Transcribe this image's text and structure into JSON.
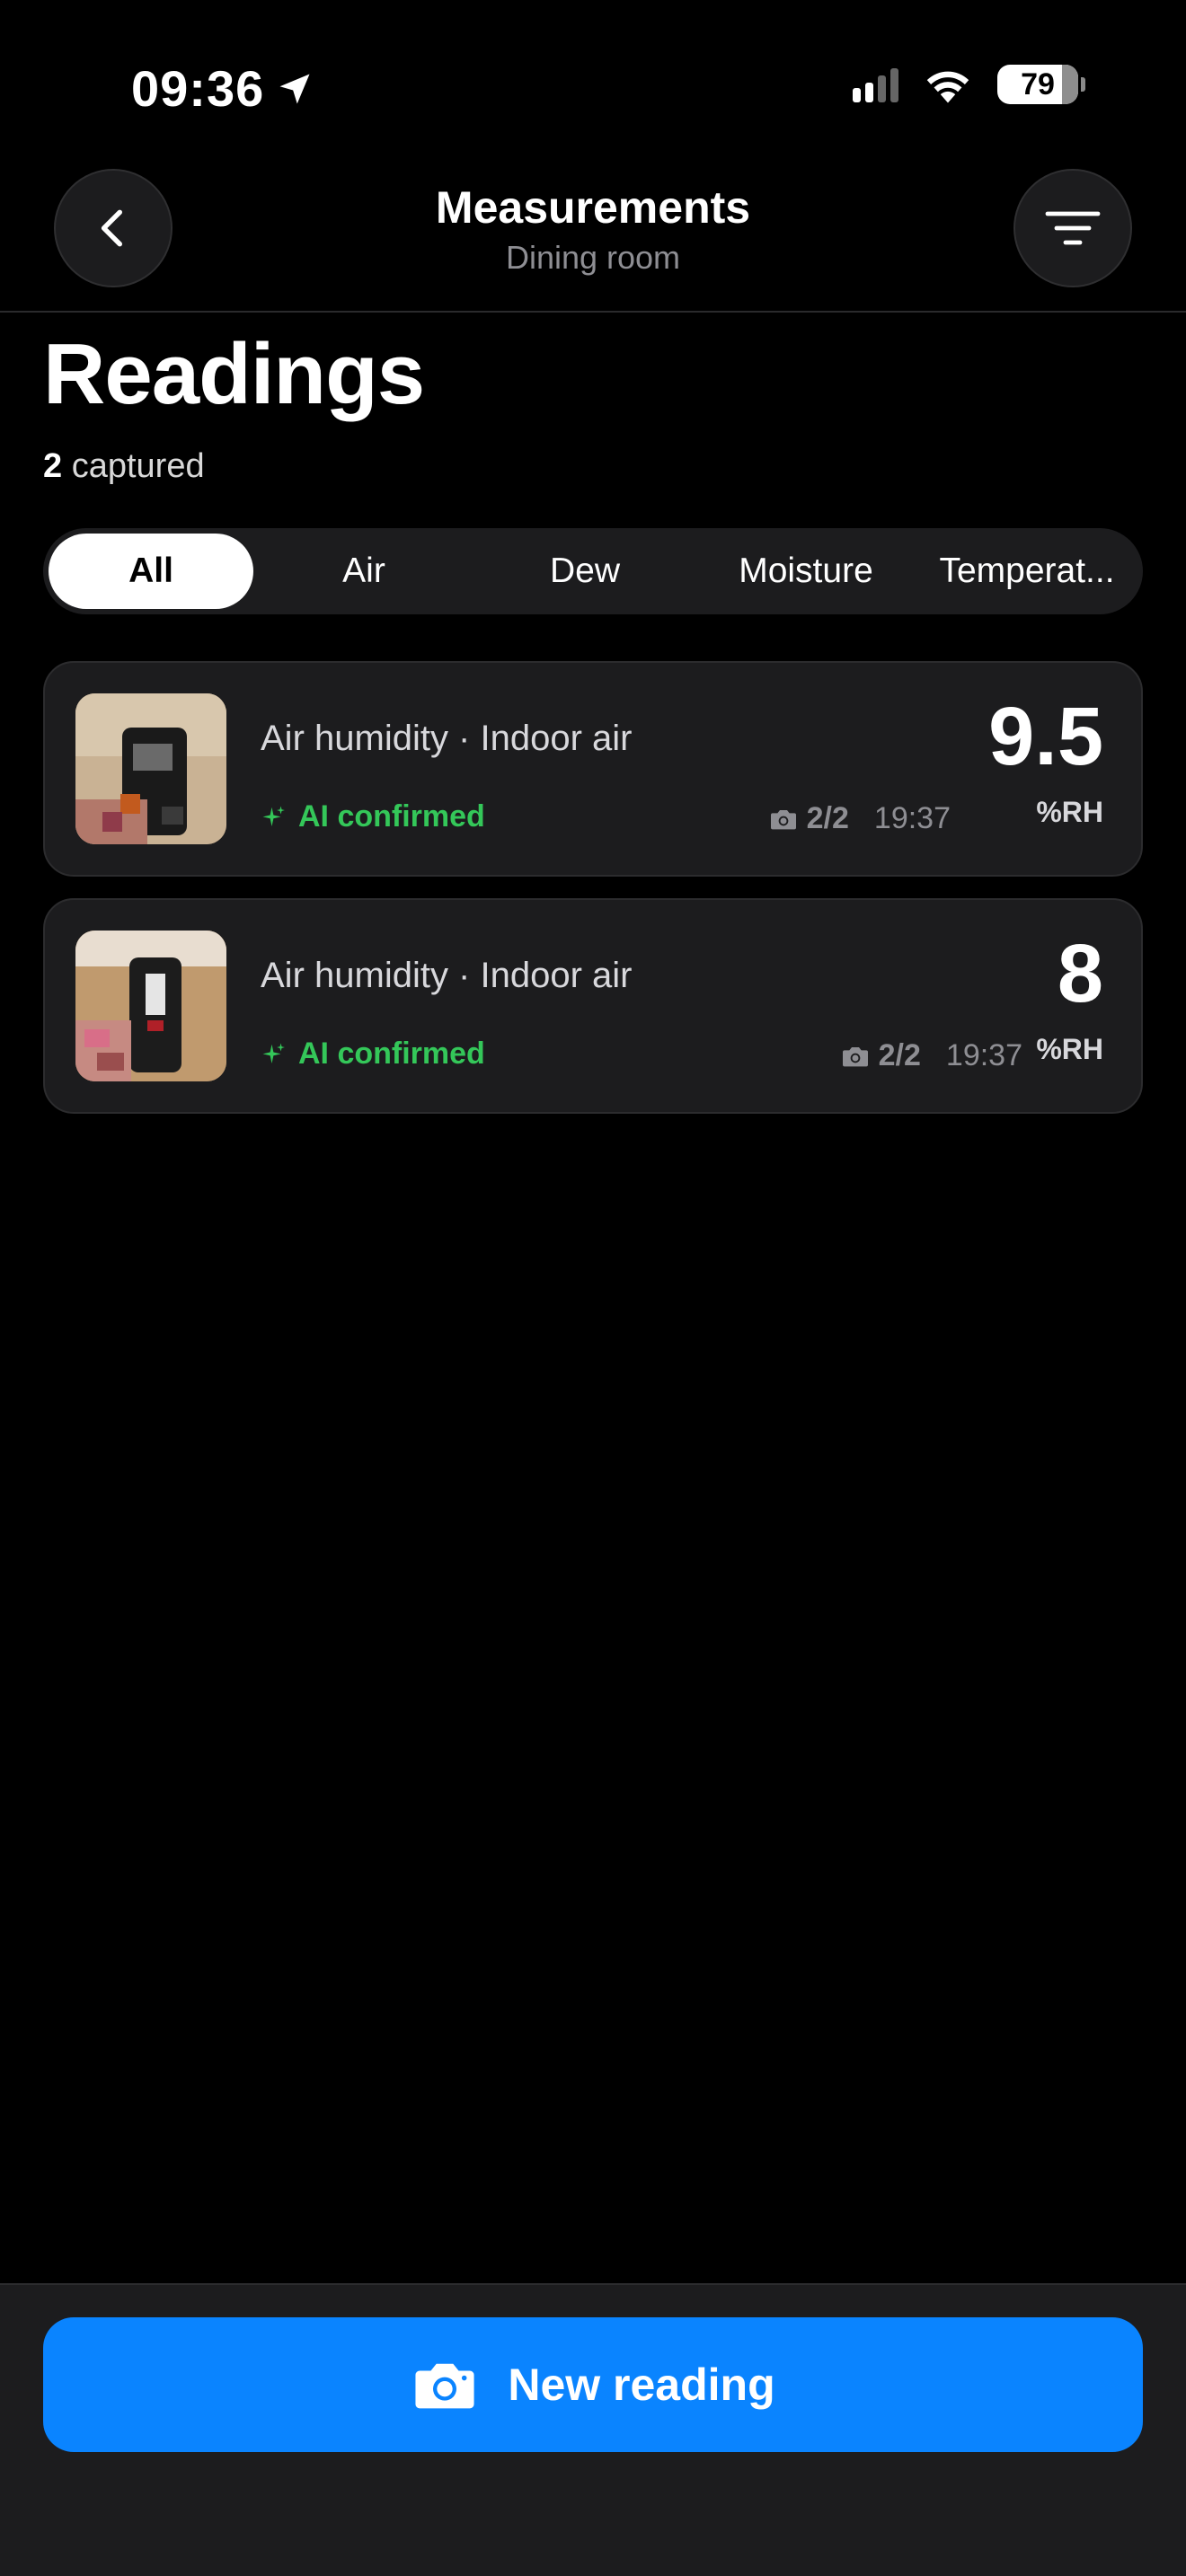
{
  "status_bar": {
    "time": "09:36",
    "battery": "79"
  },
  "nav": {
    "title": "Measurements",
    "subtitle": "Dining room"
  },
  "main": {
    "title": "Readings",
    "count": "2",
    "count_label": "captured"
  },
  "filters": {
    "selected": "All",
    "items": [
      {
        "label": "All"
      },
      {
        "label": "Air"
      },
      {
        "label": "Dew"
      },
      {
        "label": "Moisture"
      },
      {
        "label": "Temperat..."
      }
    ]
  },
  "readings": [
    {
      "title": "Air humidity · Indoor air",
      "status": "AI confirmed",
      "photos": "2/2",
      "time": "19:37",
      "value": "9.5",
      "unit": "%RH"
    },
    {
      "title": "Air humidity · Indoor air",
      "status": "AI confirmed",
      "photos": "2/2",
      "time": "19:37",
      "value": "8",
      "unit": "%RH"
    }
  ],
  "actions": {
    "new_reading": "New reading"
  },
  "colors": {
    "accent": "#0a84ff",
    "success": "#34c759",
    "background": "#000000",
    "card": "#1c1c1e"
  }
}
